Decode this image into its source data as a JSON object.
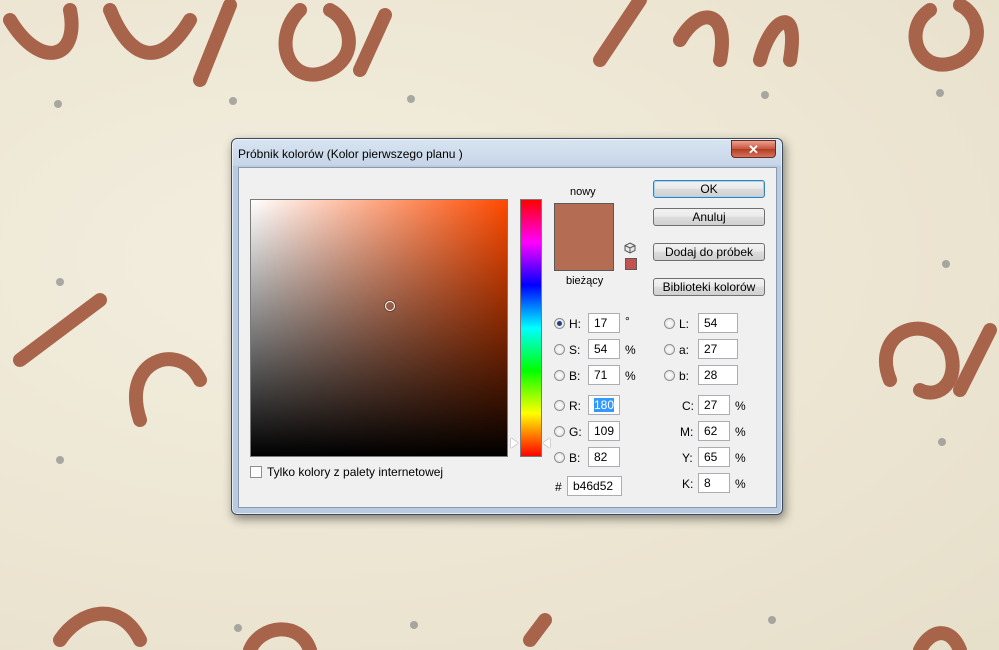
{
  "dialog": {
    "title": "Próbnik kolorów (Kolor pierwszego planu )",
    "close_glyph": "✕"
  },
  "swatch": {
    "new_label": "nowy",
    "current_label": "bieżący",
    "new_color": "#b46d52",
    "current_color": "#b46d52",
    "gamut_color": "#c4524e"
  },
  "buttons": {
    "ok": "OK",
    "cancel": "Anuluj",
    "add_swatches": "Dodaj do próbek",
    "color_libraries": "Biblioteki kolorów"
  },
  "hsb": {
    "h_label": "H:",
    "h_value": "17",
    "h_unit": "°",
    "s_label": "S:",
    "s_value": "54",
    "s_unit": "%",
    "b_label": "B:",
    "b_value": "71",
    "b_unit": "%"
  },
  "rgb": {
    "r_label": "R:",
    "r_value": "180",
    "g_label": "G:",
    "g_value": "109",
    "b_label": "B:",
    "b_value": "82"
  },
  "lab": {
    "l_label": "L:",
    "l_value": "54",
    "a_label": "a:",
    "a_value": "27",
    "b_label": "b:",
    "b_value": "28"
  },
  "cmyk": {
    "c_label": "C:",
    "c_value": "27",
    "c_unit": "%",
    "m_label": "M:",
    "m_value": "62",
    "m_unit": "%",
    "y_label": "Y:",
    "y_value": "65",
    "y_unit": "%",
    "k_label": "K:",
    "k_value": "8",
    "k_unit": "%"
  },
  "hex": {
    "label": "#",
    "value": "b46d52"
  },
  "web_only": {
    "label": "Tylko kolory z palety internetowej",
    "checked": false
  },
  "selected_mode": "H"
}
